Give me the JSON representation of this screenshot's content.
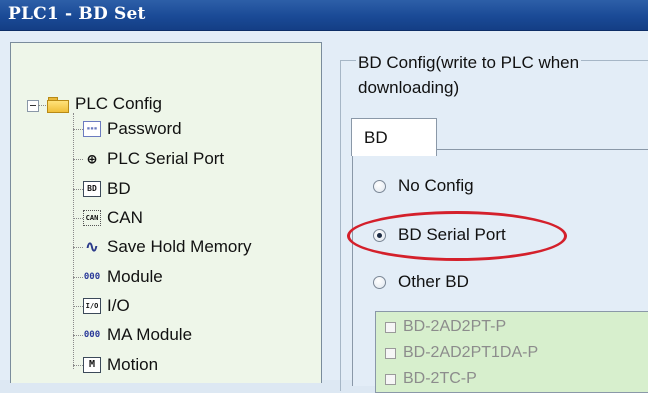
{
  "window": {
    "title": "PLC1 - BD Set"
  },
  "tree": {
    "root": {
      "label": "PLC Config",
      "icon": "folder-icon"
    },
    "items": [
      {
        "label": "Password",
        "icon": "password-icon",
        "glyph": "▪▪▪"
      },
      {
        "label": "PLC Serial Port",
        "icon": "serial-port-icon",
        "glyph": "⊕"
      },
      {
        "label": "BD",
        "icon": "bd-icon",
        "glyph": "BD"
      },
      {
        "label": "CAN",
        "icon": "can-icon",
        "glyph": "CAN"
      },
      {
        "label": "Save Hold Memory",
        "icon": "waveform-icon",
        "glyph": "∿"
      },
      {
        "label": "Module",
        "icon": "module-icon",
        "glyph": "000"
      },
      {
        "label": "I/O",
        "icon": "io-icon",
        "glyph": "I/O"
      },
      {
        "label": "MA Module",
        "icon": "ma-module-icon",
        "glyph": "000"
      },
      {
        "label": "Motion",
        "icon": "motion-icon",
        "glyph": "M"
      }
    ]
  },
  "bd_config": {
    "group_title": "BD Config(write to PLC when\ndownloading)",
    "tab_label": "BD",
    "options": [
      {
        "label": "No Config",
        "selected": false
      },
      {
        "label": "BD Serial Port",
        "selected": true
      },
      {
        "label": "Other BD",
        "selected": false
      }
    ],
    "other_bd_list": [
      "BD-2AD2PT-P",
      "BD-2AD2PT1DA-P",
      "BD-2TC-P"
    ],
    "highlight_color": "#d4202b"
  }
}
